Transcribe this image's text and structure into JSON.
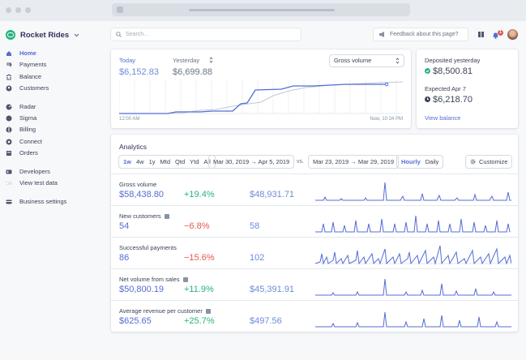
{
  "brand": {
    "name": "Rocket Rides"
  },
  "sidebar": {
    "items": [
      {
        "label": "Home"
      },
      {
        "label": "Payments"
      },
      {
        "label": "Balance"
      },
      {
        "label": "Customers"
      },
      {
        "label": "Radar"
      },
      {
        "label": "Sigma"
      },
      {
        "label": "Billing"
      },
      {
        "label": "Connect"
      },
      {
        "label": "Orders"
      },
      {
        "label": "Developers"
      },
      {
        "label": "View test data"
      },
      {
        "label": "Business settings"
      }
    ]
  },
  "header": {
    "search_placeholder": "Search...",
    "feedback": "Feedback about this page?",
    "notif_count": "1"
  },
  "today": {
    "today_label": "Today",
    "today_value": "$6,152.83",
    "yesterday_label": "Yesterday",
    "yesterday_value": "$6,699.88",
    "metric_select": "Gross volume",
    "time_start": "12:00 AM",
    "time_end": "Now, 10:34 PM"
  },
  "balance": {
    "deposited_label": "Deposited yesterday",
    "deposited_value": "$8,500.81",
    "expected_label": "Expected Apr 7",
    "expected_value": "$6,218.70",
    "link": "View balance"
  },
  "analytics": {
    "title": "Analytics",
    "ranges": [
      "1w",
      "4w",
      "1y",
      "Mtd",
      "Qtd",
      "Ytd",
      "All"
    ],
    "date_range": "Mar 30, 2019 → Apr 5, 2019",
    "vs": "vs.",
    "compare_range": "Mar 23, 2019 → Mar 29, 2019",
    "granularity": [
      "Hourly",
      "Daily"
    ],
    "customize": "Customize",
    "rows": [
      {
        "title": "Gross volume",
        "value": "$58,438.80",
        "change": "+19.4%",
        "prev": "$48,931.71"
      },
      {
        "title": "New customers",
        "value": "54",
        "change": "−6.8%",
        "prev": "58"
      },
      {
        "title": "Successful payments",
        "value": "86",
        "change": "−15.6%",
        "prev": "102"
      },
      {
        "title": "Net volume from sales",
        "value": "$50,800.19",
        "change": "+11.9%",
        "prev": "$45,391.91"
      },
      {
        "title": "Average revenue per customer",
        "value": "$625.65",
        "change": "+25.7%",
        "prev": "$497.56"
      }
    ]
  },
  "colors": {
    "accent": "#556cd6",
    "positive": "#24b47e",
    "negative": "#e25950"
  }
}
